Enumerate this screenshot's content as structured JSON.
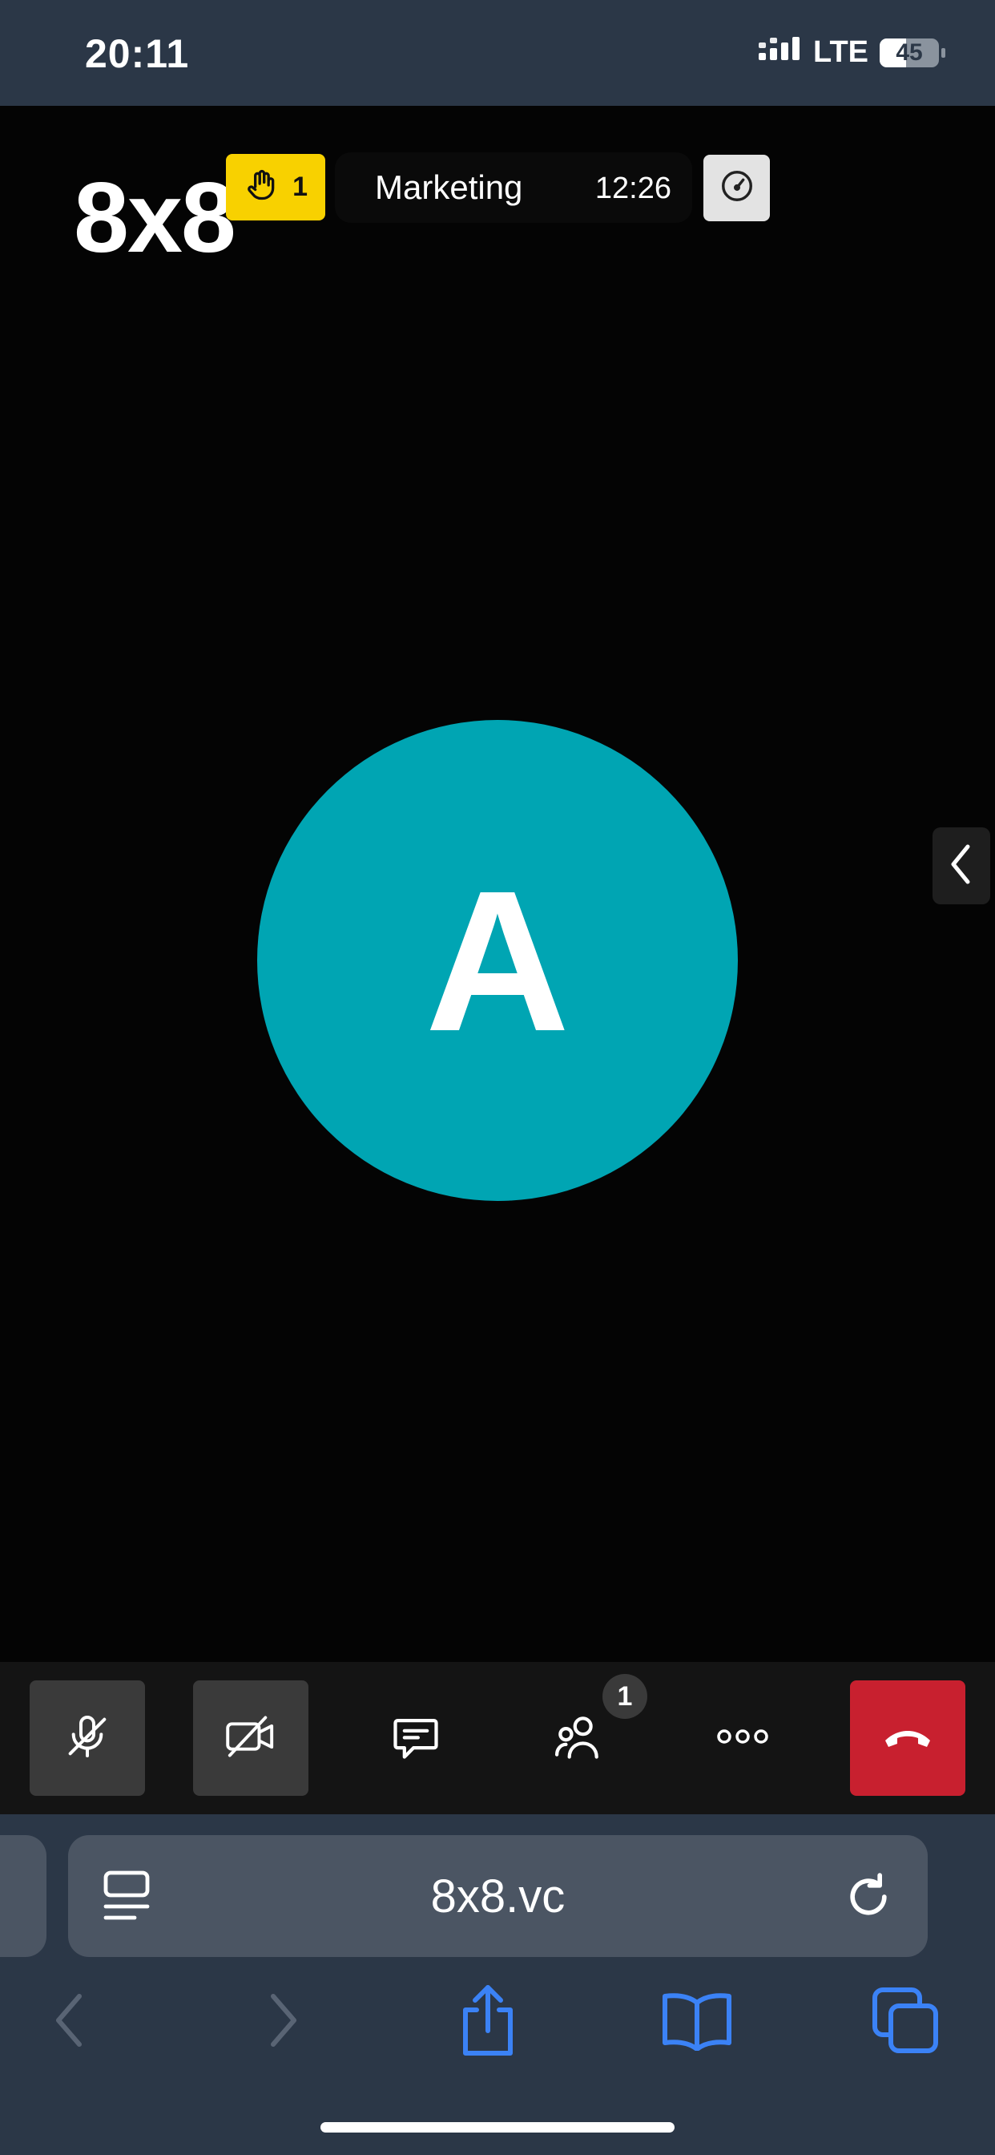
{
  "status_bar": {
    "time": "20:11",
    "network": "LTE",
    "battery": "45"
  },
  "meeting": {
    "logo": "8x8",
    "raised_hands": "1",
    "name": "Marketing",
    "timer": "12:26",
    "avatar_initial": "A"
  },
  "toolbar": {
    "participants_count": "1"
  },
  "browser": {
    "url": "8x8.vc"
  },
  "colors": {
    "avatar": "#00a5b3",
    "hangup": "#c8202f",
    "raise_hand": "#f8d100",
    "chrome": "#2b3747",
    "link_blue": "#3b82f6"
  },
  "icons": {
    "status": [
      "signal-icon",
      "battery-icon"
    ],
    "meeting": [
      "raised-hand-icon",
      "speedometer-icon",
      "chevron-left-icon"
    ],
    "toolbar": [
      "mic-off-icon",
      "camera-off-icon",
      "chat-icon",
      "participants-icon",
      "more-icon",
      "hang-up-icon"
    ],
    "browser": [
      "reader-icon",
      "reload-icon",
      "back-icon",
      "forward-icon",
      "share-icon",
      "bookmarks-icon",
      "tabs-icon"
    ]
  }
}
